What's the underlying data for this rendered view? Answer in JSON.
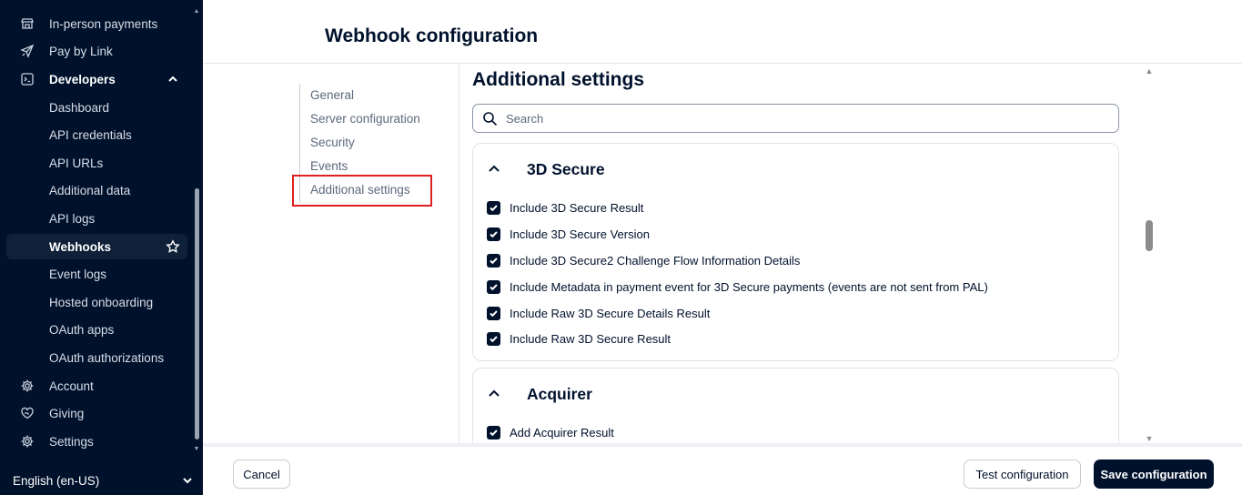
{
  "sidebar": {
    "items": [
      {
        "label": "In-person payments",
        "icon": "store-icon"
      },
      {
        "label": "Pay by Link",
        "icon": "paper-plane-icon"
      },
      {
        "label": "Developers",
        "icon": "terminal-icon"
      },
      {
        "label": "Dashboard"
      },
      {
        "label": "API credentials"
      },
      {
        "label": "API URLs"
      },
      {
        "label": "Additional data"
      },
      {
        "label": "API logs"
      },
      {
        "label": "Webhooks"
      },
      {
        "label": "Event logs"
      },
      {
        "label": "Hosted onboarding"
      },
      {
        "label": "OAuth apps"
      },
      {
        "label": "OAuth authorizations"
      },
      {
        "label": "Account",
        "icon": "gear-icon"
      },
      {
        "label": "Giving",
        "icon": "heart-hand-icon"
      },
      {
        "label": "Settings",
        "icon": "gear-icon"
      }
    ],
    "language": "English (en-US)"
  },
  "header": {
    "title": "Webhook configuration"
  },
  "subnav": {
    "items": [
      "General",
      "Server configuration",
      "Security",
      "Events",
      "Additional settings"
    ],
    "active": "Additional settings"
  },
  "content": {
    "title": "Additional settings",
    "search": {
      "placeholder": "Search",
      "value": ""
    },
    "sections": [
      {
        "title": "3D Secure",
        "expanded": true,
        "options": [
          {
            "label": "Include 3D Secure Result",
            "checked": true
          },
          {
            "label": "Include 3D Secure Version",
            "checked": true
          },
          {
            "label": "Include 3D Secure2 Challenge Flow Information Details",
            "checked": true
          },
          {
            "label": "Include Metadata in payment event for 3D Secure payments (events are not sent from PAL)",
            "checked": true
          },
          {
            "label": "Include Raw 3D Secure Details Result",
            "checked": true
          },
          {
            "label": "Include Raw 3D Secure Result",
            "checked": true
          }
        ]
      },
      {
        "title": "Acquirer",
        "expanded": true,
        "options": [
          {
            "label": "Add Acquirer Result",
            "checked": true
          }
        ]
      }
    ]
  },
  "footer": {
    "cancel_label": "Cancel",
    "test_label": "Test configuration",
    "save_label": "Save configuration"
  },
  "colors": {
    "brand_dark": "#00112c",
    "highlight": "#e02020"
  }
}
